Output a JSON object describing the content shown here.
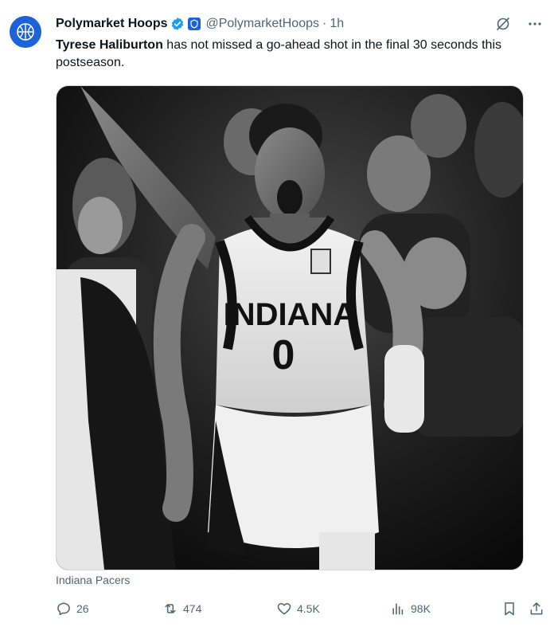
{
  "author": {
    "display_name": "Polymarket Hoops",
    "handle": "@PolymarketHoops",
    "separator": "·",
    "time": "1h",
    "avatar_icon": "basketball-globe-icon",
    "verified_icon": "verified-badge-icon",
    "affiliation_icon": "affiliate-badge-icon"
  },
  "tweet": {
    "bold_text": "Tyrese Haliburton",
    "text": " has not missed a go-ahead shot in the final 30 seconds this postseason."
  },
  "media": {
    "jersey_team": "INDIANA",
    "jersey_number": "0",
    "tagged": "Indiana Pacers"
  },
  "actions": {
    "replies": "26",
    "reposts": "474",
    "likes": "4.5K",
    "views": "98K"
  },
  "colors": {
    "accent": "#1d9bf0",
    "avatar_bg": "#1d62d8",
    "muted": "#536471"
  }
}
